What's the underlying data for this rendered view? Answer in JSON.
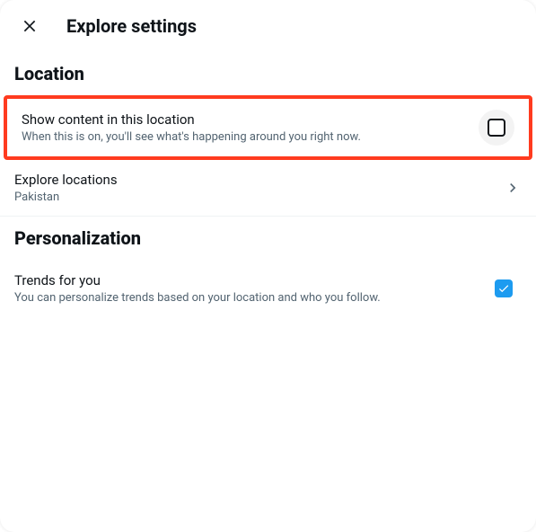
{
  "header": {
    "title": "Explore settings"
  },
  "sections": {
    "location": {
      "heading": "Location",
      "show_content": {
        "label": "Show content in this location",
        "desc": "When this is on, you'll see what's happening around you right now.",
        "checked": false
      },
      "explore_locations": {
        "label": "Explore locations",
        "value": "Pakistan"
      }
    },
    "personalization": {
      "heading": "Personalization",
      "trends": {
        "label": "Trends for you",
        "desc": "You can personalize trends based on your location and who you follow.",
        "checked": true
      }
    }
  },
  "colors": {
    "accent": "#1d9bf0",
    "highlight": "#ff3b1f",
    "text": "#0f1419",
    "subtext": "#536471"
  }
}
